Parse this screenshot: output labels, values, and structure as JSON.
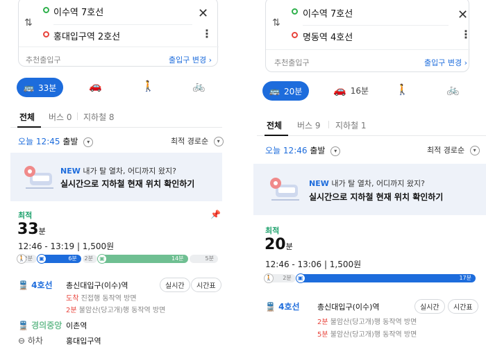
{
  "panels": [
    {
      "route": {
        "from": "이수역 7호선",
        "to": "홍대입구역 2호선",
        "recommended_exit": "추천출입구",
        "change_exit": "출입구 변경 ›"
      },
      "modes": {
        "transit_time": "33분",
        "car_time": "",
        "walk_time": "",
        "bike_time": ""
      },
      "tabs": [
        {
          "label": "전체"
        },
        {
          "label": "버스 0"
        },
        {
          "label": "지하철 8"
        }
      ],
      "depart": {
        "prefix": "오늘",
        "time": "12:45",
        "suffix": "출발"
      },
      "sort": "최적 경로순",
      "banner": {
        "line1_new": "NEW",
        "line1": " 내가 탈 열차, 어디까지 왔지?",
        "line2": "실시간으로 지하철 현재 위치 확인하기"
      },
      "result": {
        "badge": "최적",
        "minutes": "33",
        "unit": "분",
        "range_fare": "12:46 - 13:19  |  1,500원",
        "segments": [
          {
            "kind": "walk",
            "label": "2분",
            "frac": 0.1
          },
          {
            "kind": "bus",
            "label": "6분",
            "frac": 0.22
          },
          {
            "kind": "walk",
            "label": "2분",
            "frac": 0.08
          },
          {
            "kind": "green",
            "label": "14분",
            "frac": 0.45
          },
          {
            "kind": "walk",
            "label": "5분",
            "frac": 0.15
          }
        ],
        "legs": [
          {
            "line": "4호선",
            "color": "blue",
            "station": "총신대입구(이수)역",
            "btn1": "실시간",
            "btn2": "시간표",
            "arr1_a": "도착",
            "arr1_b": " 진접행  동작역 방면",
            "arr2_a": "2분",
            "arr2_b": " 불암산(당고개)행  동작역 방면"
          },
          {
            "line": "경의중앙",
            "color": "green",
            "station": "이촌역"
          },
          {
            "line": "하차",
            "color": "gray",
            "station": "홍대입구역"
          }
        ]
      }
    },
    {
      "route": {
        "from": "이수역 7호선",
        "to": "명동역 4호선",
        "recommended_exit": "추천출입구",
        "change_exit": "출입구 변경 ›"
      },
      "modes": {
        "transit_time": "20분",
        "car_time": "16분",
        "walk_time": "",
        "bike_time": ""
      },
      "tabs": [
        {
          "label": "전체"
        },
        {
          "label": "버스 9"
        },
        {
          "label": "지하철 1"
        }
      ],
      "depart": {
        "prefix": "오늘",
        "time": "12:46",
        "suffix": "출발"
      },
      "sort": "최적 경로순",
      "banner": {
        "line1_new": "NEW",
        "line1": " 내가 탈 열차, 어디까지 왔지?",
        "line2": "실시간으로 지하철 현재 위치 확인하기"
      },
      "result": {
        "badge": "최적",
        "minutes": "20",
        "unit": "분",
        "range_fare": "12:46 - 13:06  |  1,500원",
        "segments": [
          {
            "kind": "walk",
            "label": "2분",
            "frac": 0.15
          },
          {
            "kind": "bus",
            "label": "17분",
            "frac": 0.85
          }
        ],
        "legs": [
          {
            "line": "4호선",
            "color": "blue",
            "station": "총신대입구(이수)역",
            "btn1": "실시간",
            "btn2": "시간표",
            "arr1_a": "2분",
            "arr1_b": " 불암산(당고개)행  동작역 방면",
            "arr2_a": "5분",
            "arr2_b": " 불암산(당고개)행  동작역 방면"
          }
        ]
      }
    }
  ],
  "colors": {
    "accent": "#1d6cdc",
    "green_line": "#6fbf92",
    "red": "#e8423a",
    "best": "#1aa06a"
  }
}
